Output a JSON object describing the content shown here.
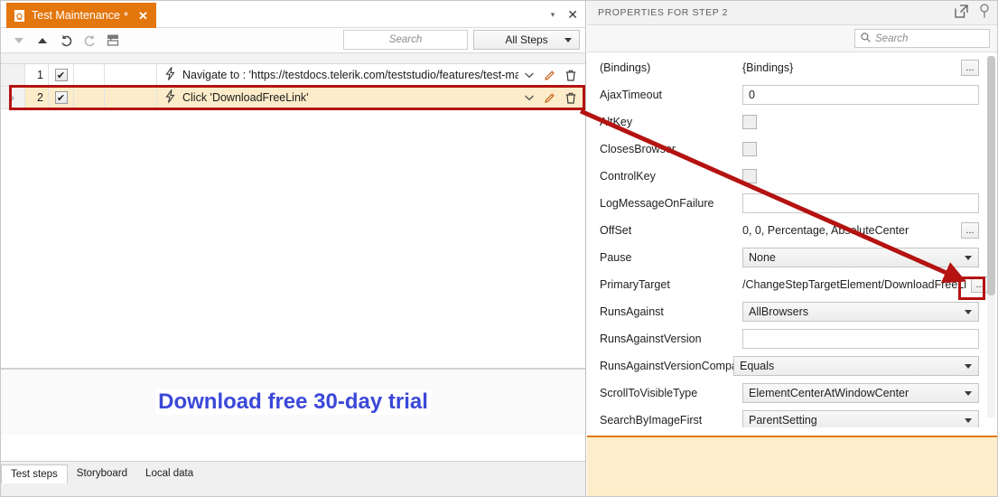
{
  "document_tab": {
    "icon": "document-icon",
    "title": "Test Maintenance",
    "dirty_marker": "*",
    "close_label": "✕"
  },
  "tabstrip": {
    "overflow_caret": "▾",
    "close_label": "✕"
  },
  "toolbar": {
    "buttons": [
      {
        "name": "move-down-button",
        "icon": "triangle-down-icon"
      },
      {
        "name": "move-up-button",
        "icon": "triangle-up-icon"
      },
      {
        "name": "undo-button",
        "icon": "undo-icon"
      },
      {
        "name": "redo-button",
        "icon": "redo-icon"
      },
      {
        "name": "group-steps-button",
        "icon": "table-icon"
      }
    ],
    "search_placeholder": "Search",
    "filter_value": "All Steps"
  },
  "grid": {
    "rows": [
      {
        "number": "1",
        "checked": true,
        "check_glyph": "✔",
        "icon": "lightning-icon",
        "text": "Navigate to : 'https://testdocs.telerik.com/teststudio/features/test-mair",
        "selected": false,
        "expander": ""
      },
      {
        "number": "2",
        "checked": true,
        "check_glyph": "✔",
        "icon": "lightning-icon",
        "text": "Click 'DownloadFreeLink'",
        "selected": true,
        "expander": "›"
      }
    ],
    "row_actions": {
      "dropdown": "chevron-down-icon",
      "edit": "pencil-icon",
      "delete": "trash-icon"
    }
  },
  "preview": {
    "link_text": "Download free 30-day trial"
  },
  "bottom_tabs": [
    {
      "label": "Test steps",
      "active": true
    },
    {
      "label": "Storyboard",
      "active": false
    },
    {
      "label": "Local data",
      "active": false
    }
  ],
  "properties_panel": {
    "title": "PROPERTIES FOR STEP 2",
    "header_icons": [
      {
        "name": "open-external-icon"
      },
      {
        "name": "pin-icon"
      }
    ],
    "search_placeholder": "Search",
    "search_icon": "search-icon",
    "rows": [
      {
        "name": "(Bindings)",
        "kind": "text-ellipsis",
        "value": "{Bindings}"
      },
      {
        "name": "AjaxTimeout",
        "kind": "input",
        "value": "0"
      },
      {
        "name": "AltKey",
        "kind": "checkbox",
        "value": ""
      },
      {
        "name": "ClosesBrowser",
        "kind": "checkbox",
        "value": ""
      },
      {
        "name": "ControlKey",
        "kind": "checkbox",
        "value": ""
      },
      {
        "name": "LogMessageOnFailure",
        "kind": "input",
        "value": ""
      },
      {
        "name": "OffSet",
        "kind": "text-ellipsis",
        "value": "0, 0, Percentage, AbsoluteCenter"
      },
      {
        "name": "Pause",
        "kind": "combo",
        "value": "None"
      },
      {
        "name": "PrimaryTarget",
        "kind": "text-ellipsis",
        "value": "/ChangeStepTargetElement/DownloadFreeLi",
        "highlight_ellipsis": true
      },
      {
        "name": "RunsAgainst",
        "kind": "combo",
        "value": "AllBrowsers"
      },
      {
        "name": "RunsAgainstVersion",
        "kind": "input",
        "value": ""
      },
      {
        "name": "RunsAgainstVersionCompare",
        "kind": "combo-wide",
        "value": "Equals"
      },
      {
        "name": "ScrollToVisibleType",
        "kind": "combo",
        "value": "ElementCenterAtWindowCenter"
      },
      {
        "name": "SearchByImageFirst",
        "kind": "combo",
        "value": "ParentSetting"
      }
    ]
  },
  "annotations": {
    "accent_red": "#b51212",
    "selected_row_box": true,
    "primary_target_button_box": true,
    "arrow": "red-arrow"
  },
  "colors": {
    "tab_orange": "#e4760e",
    "selected_row": "#fcecc9",
    "link_blue": "#3b48d8",
    "description_panel": "#fdeecb"
  }
}
